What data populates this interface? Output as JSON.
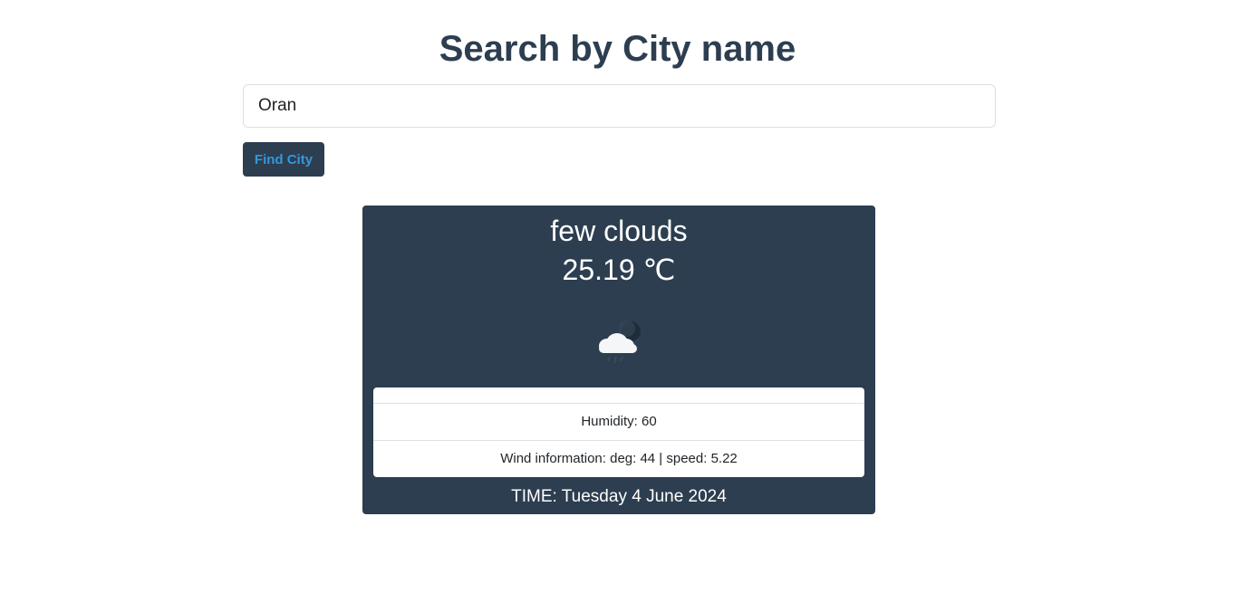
{
  "header": {
    "title": "Search by City name"
  },
  "search": {
    "value": "Oran",
    "button_label": "Find City"
  },
  "weather": {
    "condition": "few clouds",
    "temperature": "25.19 ℃",
    "icon": "cloud-night-rain-icon",
    "humidity": "Humidity: 60",
    "wind": "Wind information: deg: 44 | speed: 5.22",
    "time": "TIME: Tuesday 4 June 2024"
  },
  "colors": {
    "primary": "#2c3e50",
    "button_text": "#3498db",
    "card_text": "#ffffff"
  }
}
